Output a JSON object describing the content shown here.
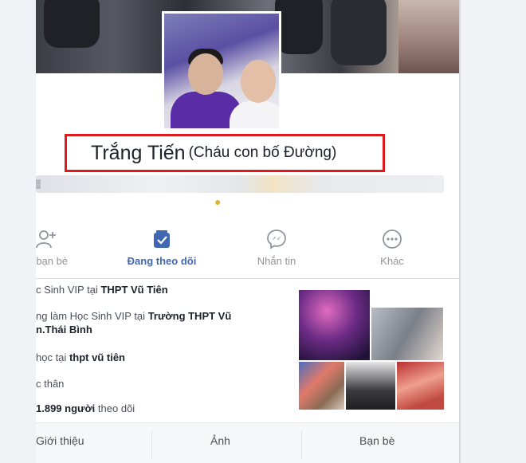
{
  "profile": {
    "name": "Trắng Tiến",
    "alternate_name": "(Cháu con bố Đường)"
  },
  "actions": [
    {
      "label": "m bạn bè",
      "icon": "add-friend-icon"
    },
    {
      "label": "Đang theo dõi",
      "icon": "following-icon"
    },
    {
      "label": "Nhắn tin",
      "icon": "messenger-icon"
    },
    {
      "label": "Khác",
      "icon": "more-icon"
    }
  ],
  "intro": {
    "work1_prefix": "c Sinh VIP tại",
    "work1_place": "THPT Vũ Tiên",
    "work2_prefix": "ng làm Học Sinh VIP tại",
    "work2_place_line1": "Trường THPT Vũ",
    "work2_place_line2": "n.Thái Bình",
    "study_prefix": "học tại",
    "study_place": "thpt vũ tiên",
    "relationship": "c thân",
    "followers_count": "1.899 người",
    "followers_suffix": "theo dõi"
  },
  "bottom_tabs": [
    "Giới thiệu",
    "Ảnh",
    "Bạn bè"
  ],
  "colors": {
    "highlight_box": "#e0191c",
    "active_blue": "#4267b2"
  }
}
